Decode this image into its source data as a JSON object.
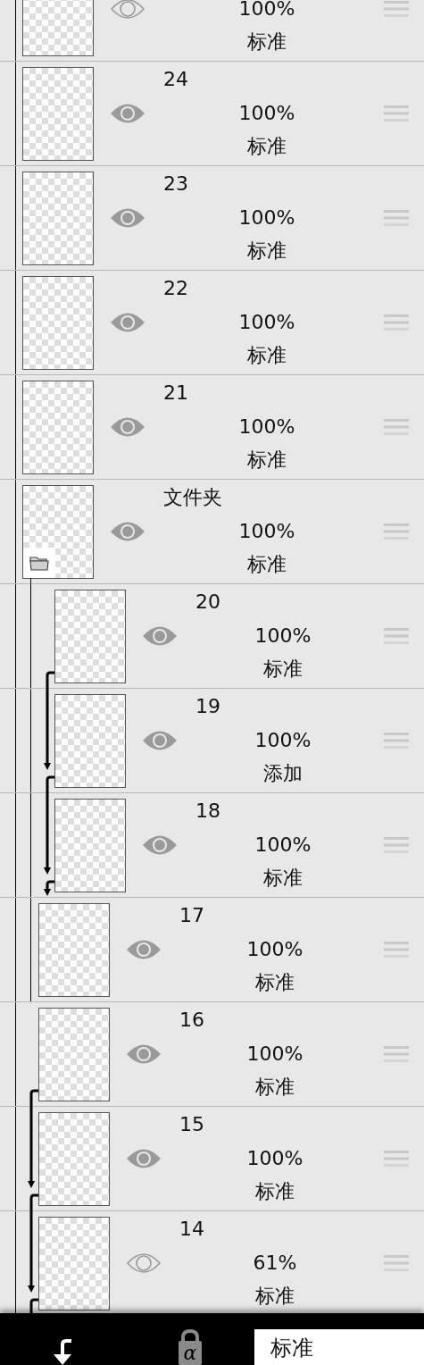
{
  "layers": [
    {
      "kind": "layer",
      "opacity": "100%",
      "blend": "标准",
      "visible": false,
      "clipped": false
    },
    {
      "kind": "layer",
      "name": "24",
      "opacity": "100%",
      "blend": "标准",
      "visible": true,
      "clipped": false
    },
    {
      "kind": "layer",
      "name": "23",
      "opacity": "100%",
      "blend": "标准",
      "visible": true,
      "clipped": false
    },
    {
      "kind": "layer",
      "name": "22",
      "opacity": "100%",
      "blend": "标准",
      "visible": true,
      "clipped": false
    },
    {
      "kind": "layer",
      "name": "21",
      "opacity": "100%",
      "blend": "标准",
      "visible": true,
      "clipped": false
    },
    {
      "kind": "folder",
      "name": "文件夹",
      "opacity": "100%",
      "blend": "标准",
      "visible": true,
      "clipped": false,
      "children": [
        {
          "kind": "layer",
          "name": "20",
          "opacity": "100%",
          "blend": "标准",
          "visible": true,
          "clipped": true
        },
        {
          "kind": "layer",
          "name": "19",
          "opacity": "100%",
          "blend": "添加",
          "visible": true,
          "clipped": true
        },
        {
          "kind": "layer",
          "name": "18",
          "opacity": "100%",
          "blend": "标准",
          "visible": true,
          "clipped": true
        },
        {
          "kind": "layer",
          "name": "17",
          "opacity": "100%",
          "blend": "标准",
          "visible": true,
          "clipped": false
        }
      ]
    },
    {
      "kind": "layer",
      "name": "16",
      "opacity": "100%",
      "blend": "标准",
      "visible": true,
      "clipped": true
    },
    {
      "kind": "layer",
      "name": "15",
      "opacity": "100%",
      "blend": "标准",
      "visible": true,
      "clipped": true
    },
    {
      "kind": "layer",
      "name": "14",
      "opacity": "61%",
      "blend": "标准",
      "visible": false,
      "clipped": true
    }
  ],
  "toolbar": {
    "alpha_lock": "α",
    "blend_mode": "标准"
  }
}
